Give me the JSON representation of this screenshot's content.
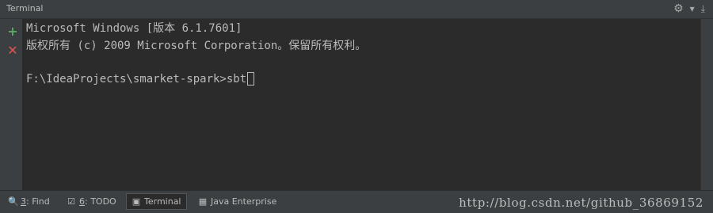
{
  "window": {
    "title": "Terminal"
  },
  "toolbar": {
    "gear_icon": "gear-icon",
    "hide_icon": "hide-panel-icon"
  },
  "gutter": {
    "add_icon": "plus-icon",
    "close_icon": "close-icon"
  },
  "terminal": {
    "lines": [
      "Microsoft Windows [版本 6.1.7601]",
      "版权所有 (c) 2009 Microsoft Corporation。保留所有权利。"
    ],
    "prompt": "F:\\IdeaProjects\\smarket-spark>",
    "command": "sbt"
  },
  "tabs": [
    {
      "key": "3",
      "label": ": Find",
      "icon": "search-icon"
    },
    {
      "key": "6",
      "label": ": TODO",
      "icon": "todo-icon"
    },
    {
      "key": "",
      "label": "Terminal",
      "icon": "terminal-icon"
    },
    {
      "key": "",
      "label": "Java Enterprise",
      "icon": "java-enterprise-icon"
    }
  ],
  "watermark": "http://blog.csdn.net/github_36869152",
  "colors": {
    "background": "#2b2b2b",
    "panel": "#3c3f41",
    "text": "#bbbbbb",
    "add": "#59a869",
    "close": "#e05555"
  }
}
